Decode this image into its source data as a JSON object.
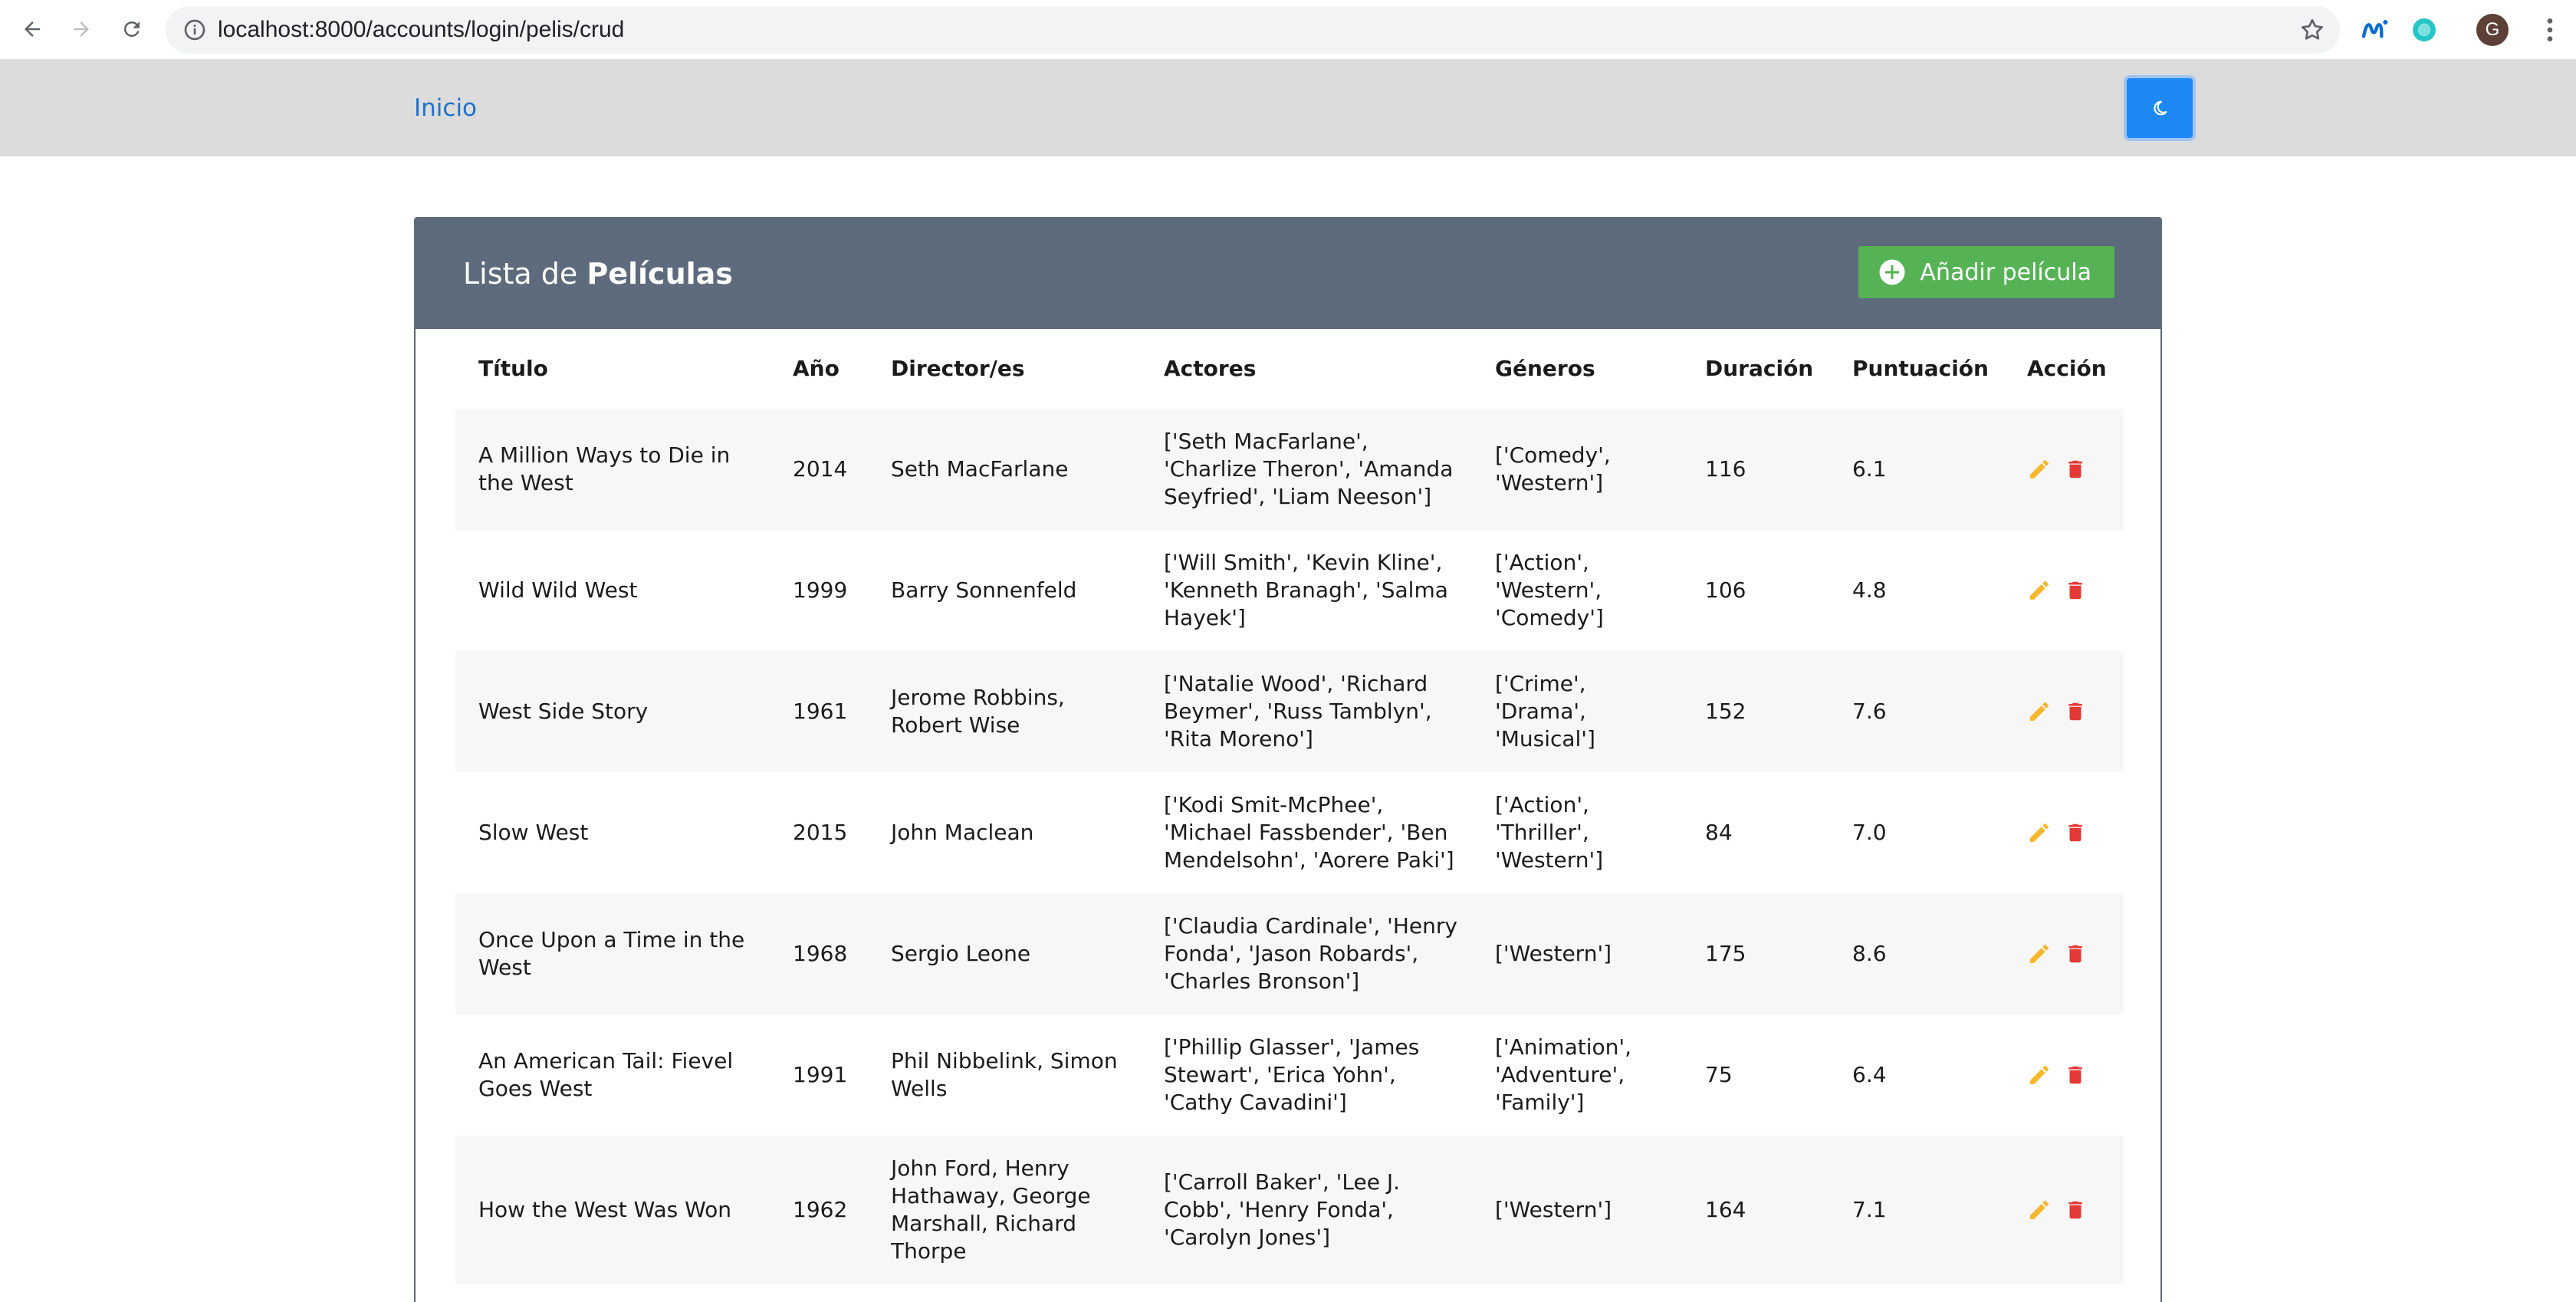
{
  "browser": {
    "url": "localhost:8000/accounts/login/pelis/crud",
    "profile_initial": "G"
  },
  "navbar": {
    "home_label": "Inicio",
    "theme_toggle_icon": "moon-icon"
  },
  "card": {
    "title_prefix": "Lista de ",
    "title_bold": "Películas",
    "add_button_label": "Añadir película"
  },
  "table": {
    "columns": [
      "Título",
      "Año",
      "Director/es",
      "Actores",
      "Géneros",
      "Duración",
      "Puntuación",
      "Acción"
    ],
    "rows": [
      {
        "title": "A Million Ways to Die in the West",
        "year": "2014",
        "directors": "Seth MacFarlane",
        "actors": "['Seth MacFarlane', 'Charlize Theron', 'Amanda Seyfried', 'Liam Neeson']",
        "genres": "['Comedy', 'Western']",
        "duration": "116",
        "rating": "6.1"
      },
      {
        "title": "Wild Wild West",
        "year": "1999",
        "directors": "Barry Sonnenfeld",
        "actors": "['Will Smith', 'Kevin Kline', 'Kenneth Branagh', 'Salma Hayek']",
        "genres": "['Action', 'Western', 'Comedy']",
        "duration": "106",
        "rating": "4.8"
      },
      {
        "title": "West Side Story",
        "year": "1961",
        "directors": "Jerome Robbins, Robert Wise",
        "actors": "['Natalie Wood', 'Richard Beymer', 'Russ Tamblyn', 'Rita Moreno']",
        "genres": "['Crime', 'Drama', 'Musical']",
        "duration": "152",
        "rating": "7.6"
      },
      {
        "title": "Slow West",
        "year": "2015",
        "directors": "John Maclean",
        "actors": "['Kodi Smit-McPhee', 'Michael Fassbender', 'Ben Mendelsohn', 'Aorere Paki']",
        "genres": "['Action', 'Thriller', 'Western']",
        "duration": "84",
        "rating": "7.0"
      },
      {
        "title": "Once Upon a Time in the West",
        "year": "1968",
        "directors": "Sergio Leone",
        "actors": "['Claudia Cardinale', 'Henry Fonda', 'Jason Robards', 'Charles Bronson']",
        "genres": "['Western']",
        "duration": "175",
        "rating": "8.6"
      },
      {
        "title": "An American Tail: Fievel Goes West",
        "year": "1991",
        "directors": "Phil Nibbelink, Simon Wells",
        "actors": "['Phillip Glasser', 'James Stewart', 'Erica Yohn', 'Cathy Cavadini']",
        "genres": "['Animation', 'Adventure', 'Family']",
        "duration": "75",
        "rating": "6.4"
      },
      {
        "title": "How the West Was Won",
        "year": "1962",
        "directors": "John Ford, Henry Hathaway, George Marshall, Richard Thorpe",
        "actors": "['Carroll Baker', 'Lee J. Cobb', 'Henry Fonda', 'Carolyn Jones']",
        "genres": "['Western']",
        "duration": "164",
        "rating": "7.1"
      }
    ],
    "action_icons": [
      "pencil-icon",
      "trash-icon"
    ]
  },
  "colors": {
    "header_bg": "#5d6b7c",
    "add_button": "#55b356",
    "edit_icon": "#f5b82e",
    "delete_icon": "#e53935",
    "link": "#1f73c9",
    "toggle": "#1e88f5"
  }
}
